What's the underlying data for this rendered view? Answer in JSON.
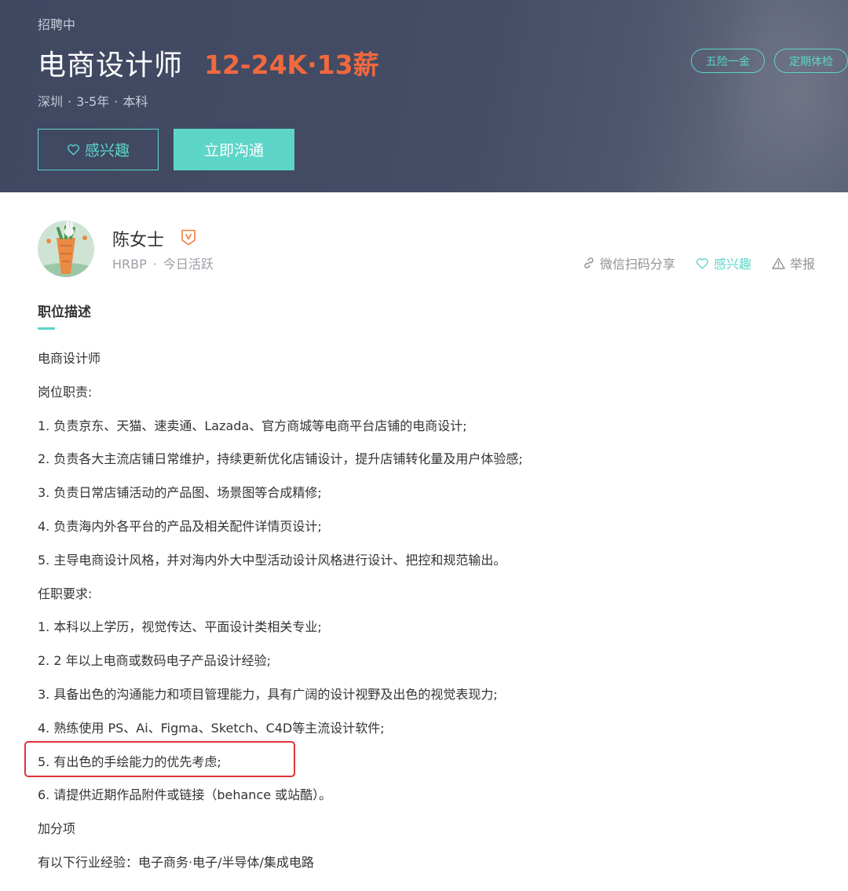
{
  "job": {
    "status": "招聘中",
    "title": "电商设计师",
    "salary": "12-24K·13薪",
    "location": "深圳",
    "experience": "3-5年",
    "education": "本科",
    "meta_separator": "·",
    "interest_button": "感兴趣",
    "chat_button": "立即沟通",
    "tags": [
      "五险一金",
      "定期体检"
    ]
  },
  "recruiter": {
    "name": "陈女士",
    "role": "HRBP",
    "separator": "·",
    "activity": "今日活跃",
    "actions": {
      "share": "微信扫码分享",
      "interest": "感兴趣",
      "report": "举报"
    }
  },
  "description": {
    "section_title": "职位描述",
    "lines": [
      "电商设计师",
      "岗位职责:",
      "1. 负责京东、天猫、速卖通、Lazada、官方商城等电商平台店铺的电商设计;",
      "2. 负责各大主流店铺日常维护，持续更新优化店铺设计，提升店铺转化量及用户体验感;",
      "3. 负责日常店铺活动的产品图、场景图等合成精修;",
      "4. 负责海内外各平台的产品及相关配件详情页设计;",
      "5. 主导电商设计风格，并对海内外大中型活动设计风格进行设计、把控和规范输出。",
      "任职要求:",
      "1. 本科以上学历，视觉传达、平面设计类相关专业;",
      "2. 2 年以上电商或数码电子产品设计经验;",
      "3. 具备出色的沟通能力和项目管理能力，具有广阔的设计视野及出色的视觉表现力;",
      "4. 熟练使用 PS、Ai、Figma、Sketch、C4D等主流设计软件;",
      "5. 有出色的手绘能力的优先考虑;",
      "6. 请提供近期作品附件或链接（behance 或站酷）。",
      "加分项",
      "有以下行业经验：电子商务·电子/半导体/集成电路"
    ]
  },
  "colors": {
    "banner": "#454d66",
    "accent_teal": "#5dd5c8",
    "salary_orange": "#f2693e",
    "highlight_red": "#e0333a",
    "badge_orange": "#f07b3f"
  },
  "icons": [
    "heart-icon",
    "verified-v-icon",
    "link-icon",
    "warning-triangle-icon"
  ]
}
